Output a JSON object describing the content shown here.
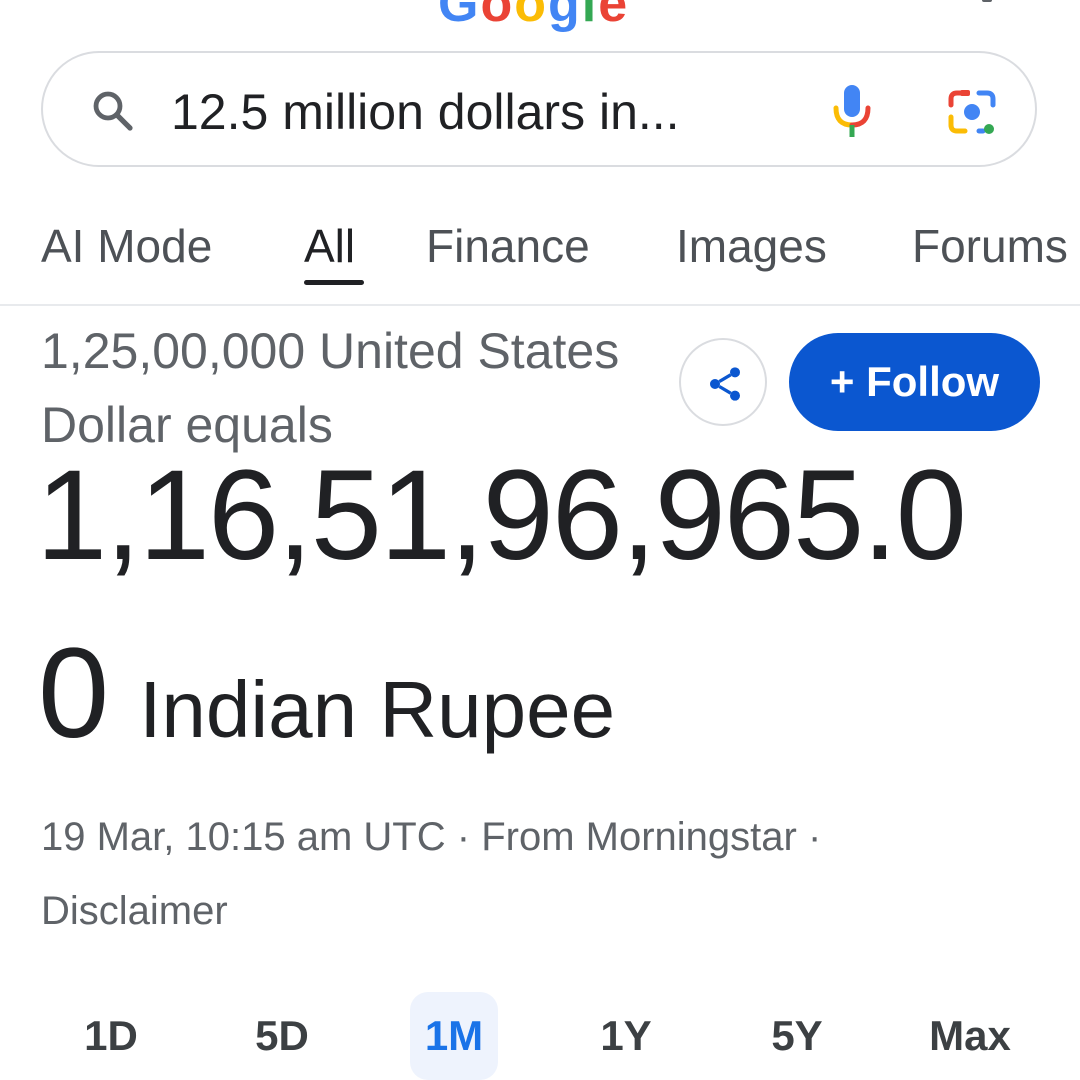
{
  "search": {
    "query": "12.5 million dollars in..."
  },
  "tabs": [
    {
      "label": "AI Mode"
    },
    {
      "label": "All"
    },
    {
      "label": "Finance"
    },
    {
      "label": "Images"
    },
    {
      "label": "Forums"
    }
  ],
  "active_tab": "All",
  "conversion": {
    "from_text": "1,25,00,000 United States Dollar equals",
    "result_value": "1,16,51,96,965.0",
    "result_tail_digit": "0",
    "result_currency": "Indian Rupee",
    "timestamp": "19 Mar, 10:15 am UTC",
    "separator": "·",
    "source": "From Morningstar",
    "disclaimer": "Disclaimer"
  },
  "actions": {
    "follow_label": "+ Follow"
  },
  "ranges": [
    {
      "label": "1D"
    },
    {
      "label": "5D"
    },
    {
      "label": "1M"
    },
    {
      "label": "1Y"
    },
    {
      "label": "5Y"
    },
    {
      "label": "Max"
    }
  ],
  "active_range": "1M",
  "colors": {
    "accent": "#0b57d0",
    "active_range_text": "#1a73e8",
    "active_range_bg": "#eef3fd",
    "google_blue": "#4285f4",
    "google_red": "#ea4335",
    "google_yellow": "#fbbc05",
    "google_green": "#34a853"
  },
  "icons": {
    "search": "search-icon",
    "mic": "mic-icon",
    "lens": "lens-icon",
    "share": "share-icon"
  }
}
